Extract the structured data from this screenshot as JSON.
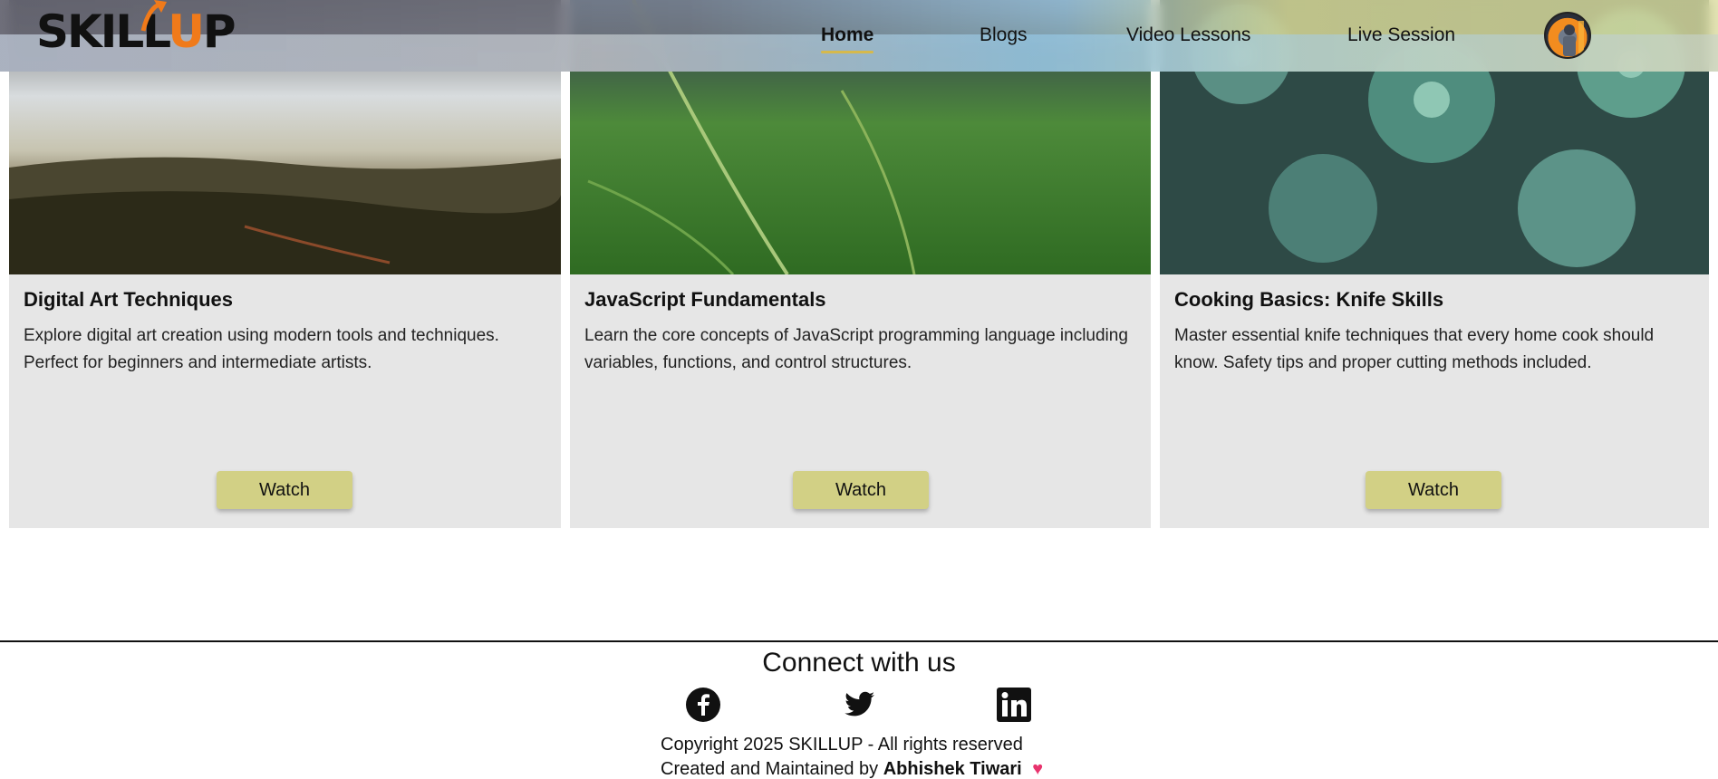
{
  "header": {
    "logo_text_a": "SKILL",
    "logo_text_u": "U",
    "logo_text_p": "P",
    "nav": [
      {
        "label": "Home",
        "active": true
      },
      {
        "label": "Blogs",
        "active": false
      },
      {
        "label": "Video Lessons",
        "active": false
      },
      {
        "label": "Live Session",
        "active": false
      }
    ],
    "avatar_icon": "user-avatar"
  },
  "cards": [
    {
      "title": "Digital Art Techniques",
      "description": "Explore digital art creation using modern tools and techniques. Perfect for beginners and intermediate artists.",
      "button": "Watch",
      "image": "landscape-hills-photo"
    },
    {
      "title": "JavaScript Fundamentals",
      "description": "Learn the core concepts of JavaScript programming language including variables, functions, and control structures.",
      "button": "Watch",
      "image": "grass-field-photo"
    },
    {
      "title": "Cooking Basics: Knife Skills",
      "description": "Master essential knife techniques that every home cook should know. Safety tips and proper cutting methods included.",
      "button": "Watch",
      "image": "succulent-plants-photo"
    }
  ],
  "footer": {
    "title": "Connect with us",
    "social": [
      "facebook-icon",
      "twitter-icon",
      "linkedin-icon"
    ],
    "copyright": "Copyright 2025 SKILLUP - All rights reserved",
    "created_prefix": "Created and Maintained by",
    "author": "Abhishek Tiwari",
    "heart": "♥"
  },
  "colors": {
    "accent": "#f07a1a",
    "button": "#d2d085",
    "card_bg": "#e6e6e6",
    "heart": "#e8336d"
  }
}
